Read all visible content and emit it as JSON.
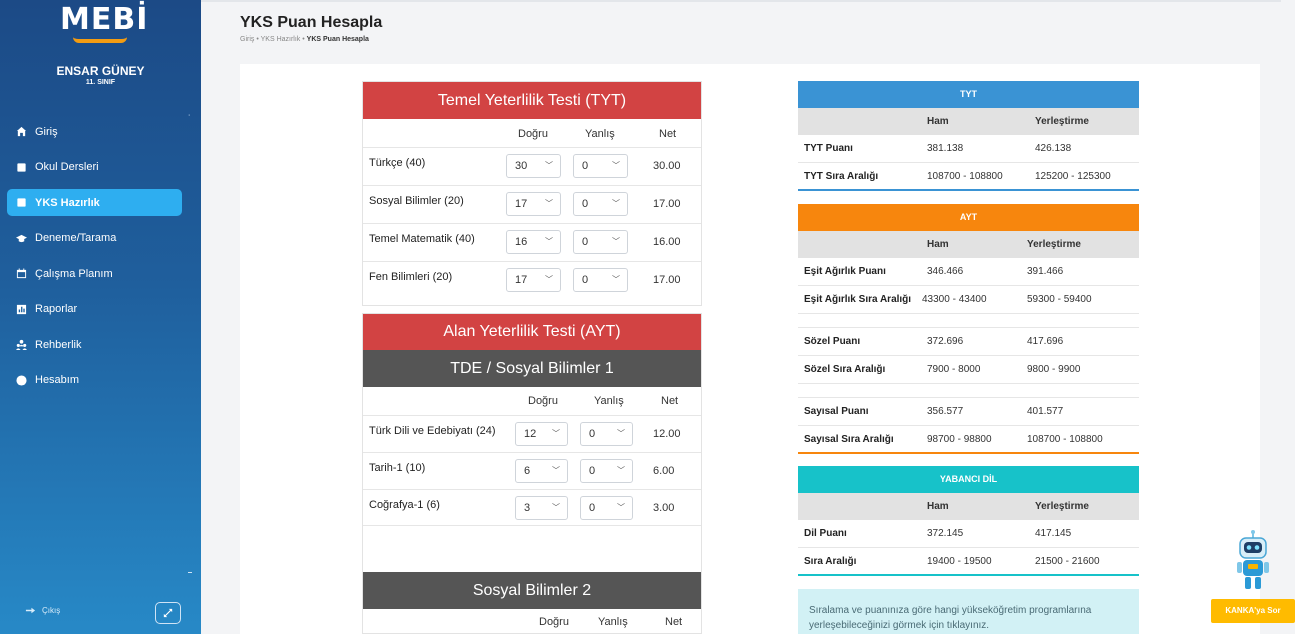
{
  "sidebar": {
    "logo": "MEBİ",
    "user_name": "ENSAR GÜNEY",
    "user_class": "11. SINIF",
    "items": [
      {
        "label": "Giriş",
        "icon": "home-icon"
      },
      {
        "label": "Okul Dersleri",
        "icon": "book-icon"
      },
      {
        "label": "YKS Hazırlık",
        "icon": "book-icon"
      },
      {
        "label": "Deneme/Tarama",
        "icon": "graduation-cap-icon"
      },
      {
        "label": "Çalışma Planım",
        "icon": "calendar-icon"
      },
      {
        "label": "Raporlar",
        "icon": "chart-icon"
      },
      {
        "label": "Rehberlik",
        "icon": "users-icon"
      },
      {
        "label": "Hesabım",
        "icon": "user-circle-icon"
      }
    ],
    "active_index": 2,
    "logout_label": "Çıkış"
  },
  "header": {
    "title": "YKS Puan Hesapla",
    "breadcrumb": [
      "Giriş",
      "YKS Hazırlık",
      "YKS Puan Hesapla"
    ]
  },
  "tyt": {
    "title": "Temel Yeterlilik Testi (TYT)",
    "col_dogru": "Doğru",
    "col_yanlis": "Yanlış",
    "col_net": "Net",
    "rows": [
      {
        "subject": "Türkçe (40)",
        "dogru": "30",
        "yanlis": "0",
        "net": "30.00"
      },
      {
        "subject": "Sosyal Bilimler (20)",
        "dogru": "17",
        "yanlis": "0",
        "net": "17.00"
      },
      {
        "subject": "Temel Matematik (40)",
        "dogru": "16",
        "yanlis": "0",
        "net": "16.00"
      },
      {
        "subject": "Fen Bilimleri (20)",
        "dogru": "17",
        "yanlis": "0",
        "net": "17.00"
      }
    ]
  },
  "ayt": {
    "title": "Alan Yeterlilik Testi (AYT)",
    "section1": {
      "title": "TDE / Sosyal Bilimler 1",
      "col_dogru": "Doğru",
      "col_yanlis": "Yanlış",
      "col_net": "Net",
      "rows": [
        {
          "subject": "Türk Dili ve Edebiyatı (24)",
          "dogru": "12",
          "yanlis": "0",
          "net": "12.00"
        },
        {
          "subject": "Tarih-1 (10)",
          "dogru": "6",
          "yanlis": "0",
          "net": "6.00"
        },
        {
          "subject": "Coğrafya-1 (6)",
          "dogru": "3",
          "yanlis": "0",
          "net": "3.00"
        }
      ]
    },
    "section2": {
      "title": "Sosyal Bilimler 2",
      "col_dogru": "Doğru",
      "col_yanlis": "Yanlış",
      "col_net": "Net"
    }
  },
  "results": {
    "col_ham": "Ham",
    "col_yerlestirme": "Yerleştirme",
    "tyt": {
      "title": "TYT",
      "color": "#3a93d4",
      "rows": [
        {
          "label": "TYT Puanı",
          "ham": "381.138",
          "yer": "426.138"
        },
        {
          "label": "TYT Sıra Aralığı",
          "ham": "108700 - 108800",
          "yer": "125200 - 125300"
        }
      ]
    },
    "ayt": {
      "title": "AYT",
      "color": "#f7860d",
      "rows": [
        {
          "label": "Eşit Ağırlık Puanı",
          "ham": "346.466",
          "yer": "391.466"
        },
        {
          "label": "Eşit Ağırlık Sıra Aralığı",
          "ham": "43300 - 43400",
          "yer": "59300 - 59400"
        },
        {
          "label": "Sözel Puanı",
          "ham": "372.696",
          "yer": "417.696"
        },
        {
          "label": "Sözel Sıra Aralığı",
          "ham": "7900 - 8000",
          "yer": "9800 - 9900"
        },
        {
          "label": "Sayısal Puanı",
          "ham": "356.577",
          "yer": "401.577"
        },
        {
          "label": "Sayısal Sıra Aralığı",
          "ham": "98700 - 98800",
          "yer": "108700 - 108800"
        }
      ]
    },
    "ydil": {
      "title": "YABANCI DİL",
      "color": "#17c2c9",
      "rows": [
        {
          "label": "Dil Puanı",
          "ham": "372.145",
          "yer": "417.145"
        },
        {
          "label": "Sıra Aralığı",
          "ham": "19400 - 19500",
          "yer": "21500 - 21600"
        }
      ]
    },
    "info": "Sıralama ve puanınıza göre hangi yükseköğretim programlarına yerleşebileceğinizi görmek için tıklayınız."
  },
  "assistant": {
    "button_label": "KANKA'ya Sor"
  }
}
